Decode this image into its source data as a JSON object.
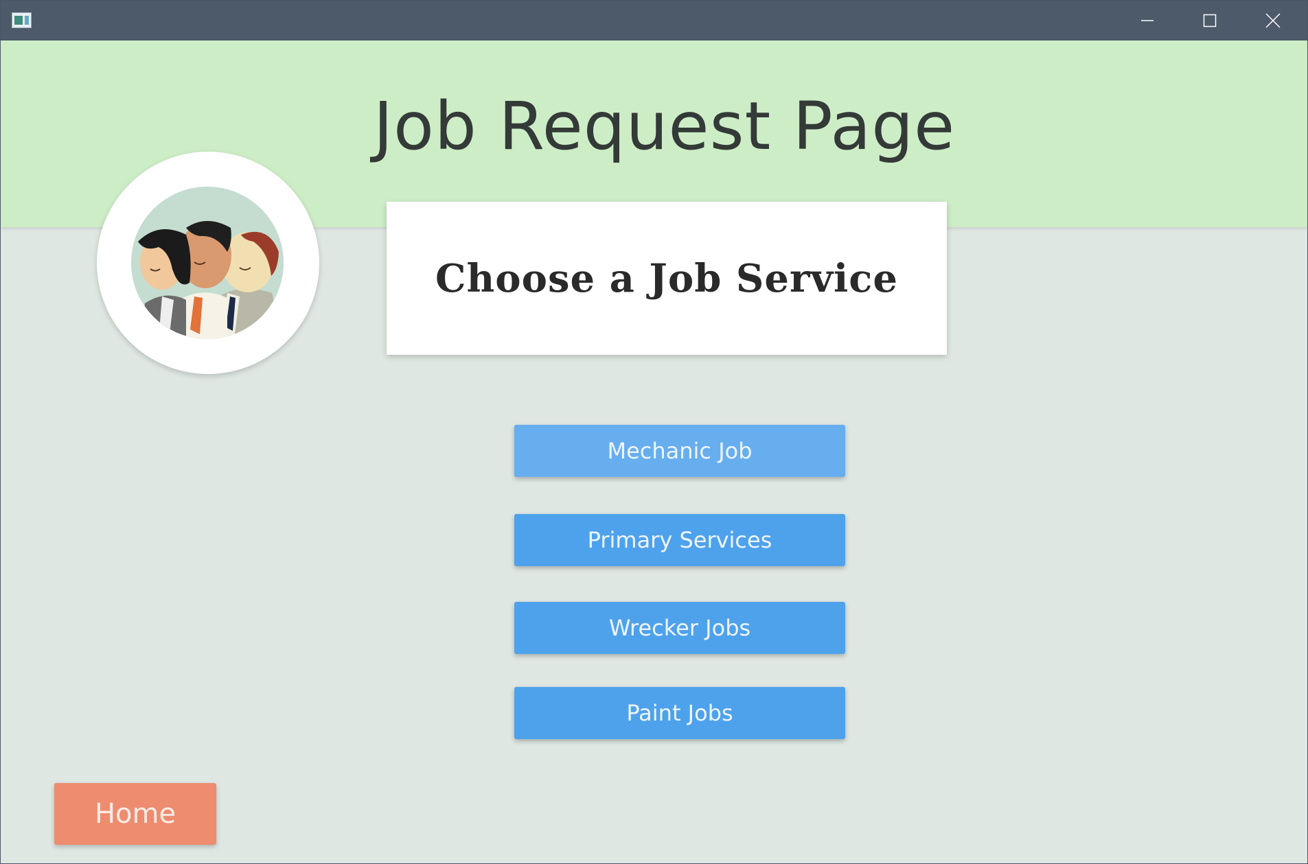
{
  "window": {
    "controls": {
      "minimize_icon": "minimize-icon",
      "maximize_icon": "maximize-icon",
      "close_icon": "close-icon"
    }
  },
  "header": {
    "title": "Job Request Page",
    "background_color": "#cdedc7"
  },
  "card": {
    "title": "Choose a Job Service"
  },
  "job_buttons": [
    {
      "label": "Mechanic Job"
    },
    {
      "label": "Primary Services"
    },
    {
      "label": "Wrecker Jobs"
    },
    {
      "label": "Paint Jobs"
    }
  ],
  "footer": {
    "home_label": "Home"
  },
  "colors": {
    "button_blue": "#4ea2ec",
    "button_blue_hover": "#67aeef",
    "home_button": "#ee8c6f",
    "body_background": "#dfe7e3",
    "titlebar": "#4d5a69"
  }
}
